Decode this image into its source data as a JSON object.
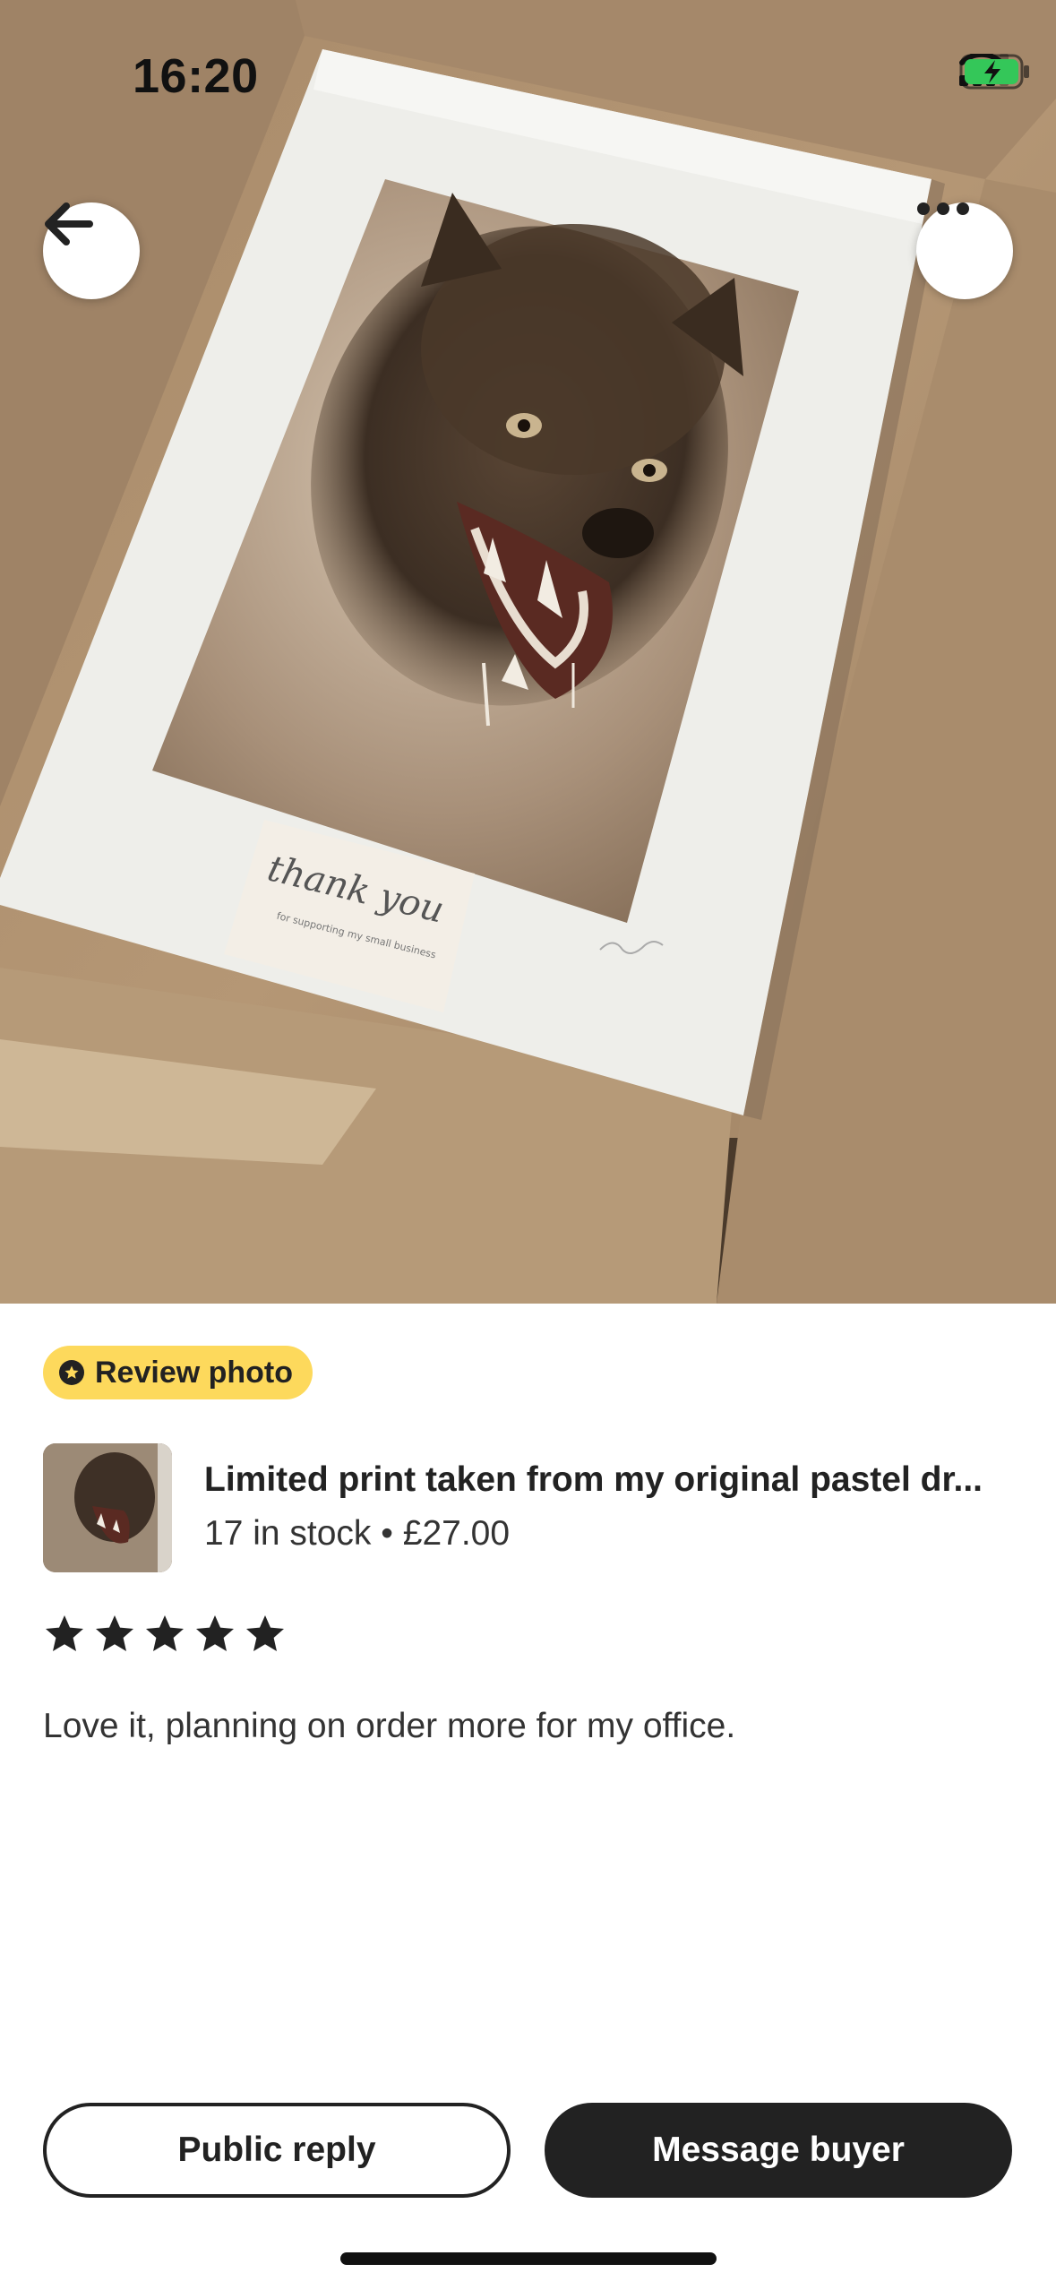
{
  "status_bar": {
    "time": "16:20"
  },
  "header": {
    "back_icon": "arrow-left-icon",
    "more_icon": "ellipsis-icon"
  },
  "photo": {
    "card_title": "thank you",
    "card_subtitle": "for supporting my small business"
  },
  "badge": {
    "label": "Review photo",
    "icon": "star-badge-icon",
    "color": "#fdd95c"
  },
  "listing": {
    "title": "Limited print taken from my original pastel dr...",
    "stock": "17 in stock",
    "separator": "•",
    "price": "£27.00"
  },
  "review": {
    "rating": 5,
    "max_rating": 5,
    "text": "Love it, planning on order more for my office."
  },
  "actions": {
    "public_reply": "Public reply",
    "message_buyer": "Message buyer"
  }
}
